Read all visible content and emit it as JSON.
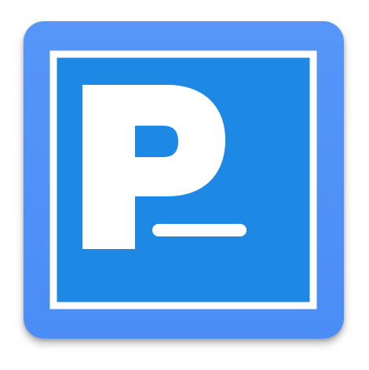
{
  "icon": {
    "name": "app-icon-p-cursor",
    "letter": "P",
    "cursor": "_",
    "colors": {
      "tile": "#4a8df6",
      "tile_top": "#5696f8",
      "inner": "#1e88e5",
      "frame": "#ffffff",
      "glyph": "#ffffff"
    }
  }
}
